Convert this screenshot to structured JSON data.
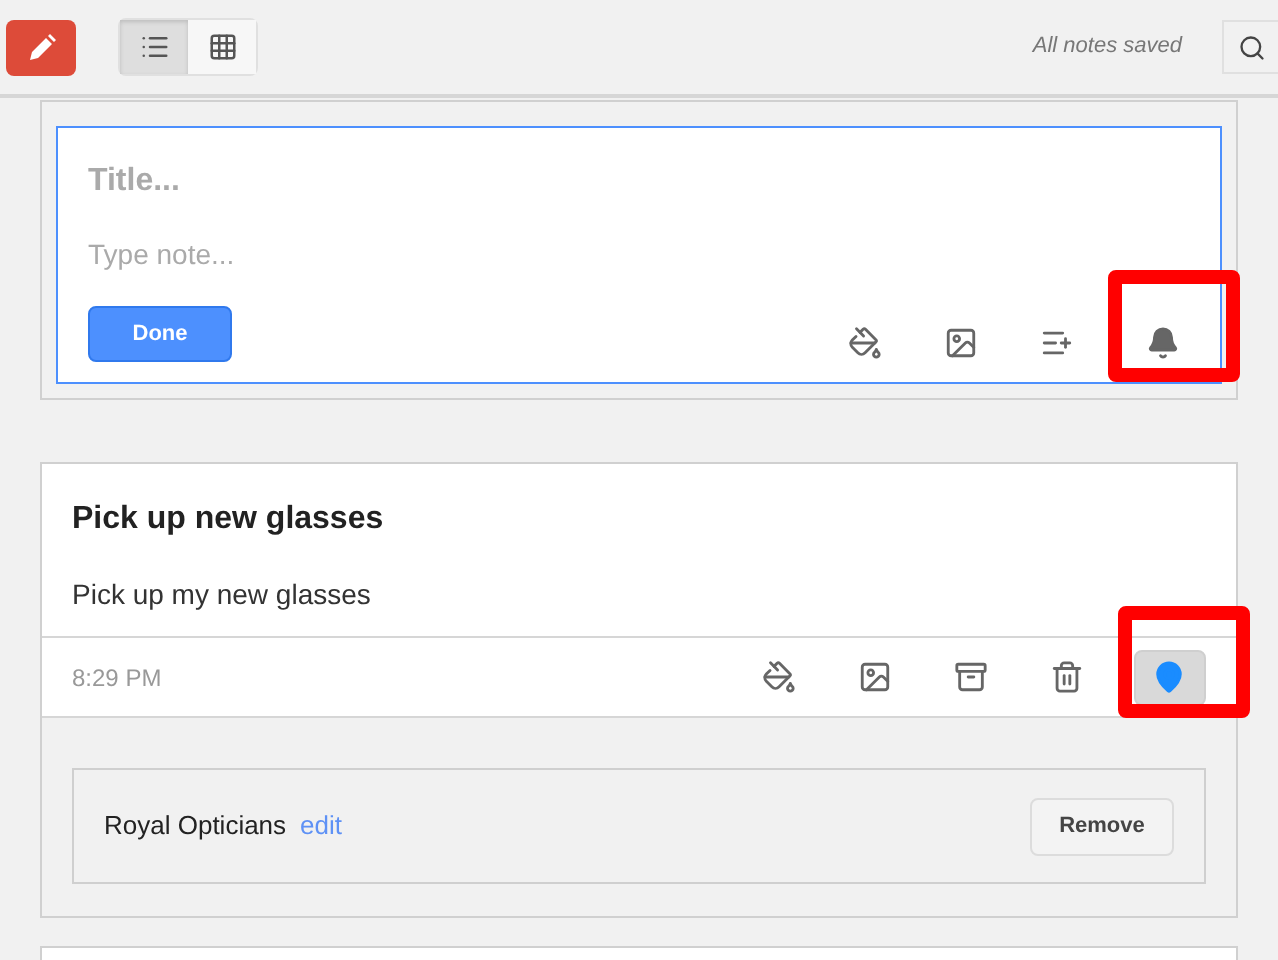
{
  "toolbar": {
    "views": [
      {
        "kind": "list",
        "selected": true
      },
      {
        "kind": "grid",
        "selected": false
      }
    ],
    "status": "All notes saved"
  },
  "composer": {
    "title_placeholder": "Title...",
    "body_placeholder": "Type note...",
    "done": "Done",
    "tools": [
      {
        "kind": "paint",
        "highlighted": false
      },
      {
        "kind": "image",
        "highlighted": false
      },
      {
        "kind": "list",
        "highlighted": false
      },
      {
        "kind": "bell",
        "highlighted": true
      }
    ]
  },
  "note": {
    "title": "Pick up new glasses",
    "body": "Pick up my new glasses",
    "time": "8:29 PM",
    "tools": [
      {
        "kind": "paint",
        "selected": false,
        "highlighted": false
      },
      {
        "kind": "image",
        "selected": false,
        "highlighted": false
      },
      {
        "kind": "archive",
        "selected": false,
        "highlighted": false
      },
      {
        "kind": "trash",
        "selected": false,
        "highlighted": false
      },
      {
        "kind": "pin",
        "selected": true,
        "highlighted": true
      }
    ],
    "location": {
      "place": "Royal Opticians",
      "edit": "edit",
      "remove": "Remove"
    }
  }
}
